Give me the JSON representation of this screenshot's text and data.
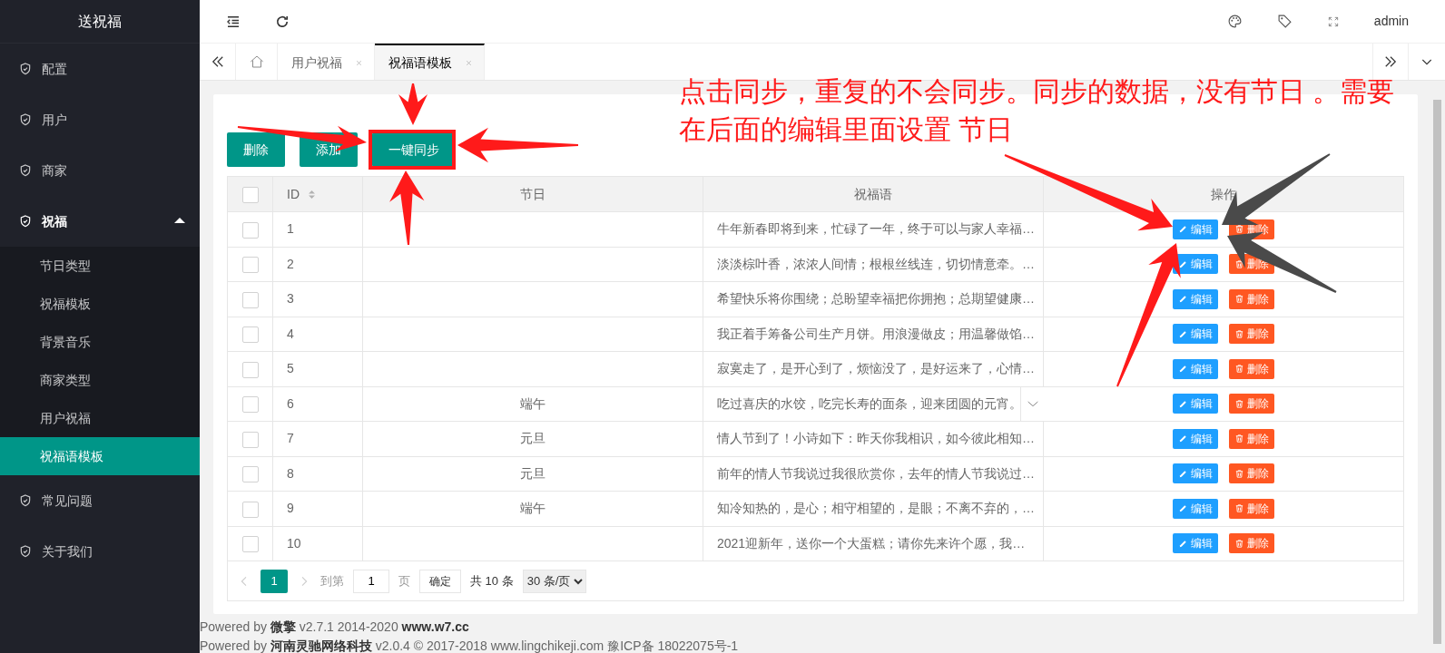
{
  "sidebar": {
    "title": "送祝福",
    "items": [
      {
        "label": "配置",
        "expanded": false
      },
      {
        "label": "用户",
        "expanded": false
      },
      {
        "label": "商家",
        "expanded": false
      },
      {
        "label": "祝福",
        "expanded": true,
        "children": [
          {
            "label": "节日类型",
            "selected": false
          },
          {
            "label": "祝福模板",
            "selected": false
          },
          {
            "label": "背景音乐",
            "selected": false
          },
          {
            "label": "商家类型",
            "selected": false
          },
          {
            "label": "用户祝福",
            "selected": false
          },
          {
            "label": "祝福语模板",
            "selected": true
          }
        ]
      },
      {
        "label": "常见问题",
        "expanded": false
      },
      {
        "label": "关于我们",
        "expanded": false
      }
    ]
  },
  "header": {
    "user": "admin"
  },
  "tabs": [
    {
      "label": "用户祝福",
      "selected": false
    },
    {
      "label": "祝福语模板",
      "selected": true
    }
  ],
  "toolbar": [
    {
      "label": "删除"
    },
    {
      "label": "添加"
    },
    {
      "label": "一键同步"
    }
  ],
  "table": {
    "header_checked": false,
    "columns": [
      {
        "kind": "checkbox"
      },
      {
        "kind": "sort",
        "label": "ID"
      },
      {
        "kind": "text",
        "label": "节日"
      },
      {
        "kind": "text",
        "label": "祝福语"
      },
      {
        "kind": "text",
        "label": "操作"
      }
    ],
    "rows": [
      {
        "checked": false,
        "id": "1",
        "festival": "",
        "text": "牛年新春即将到来，忙碌了一年，终于可以与家人幸福…",
        "expand_toggle": false,
        "actions": [
          {
            "kind": "edit",
            "label": "编辑"
          },
          {
            "kind": "delete",
            "label": "删除"
          }
        ]
      },
      {
        "checked": false,
        "id": "2",
        "festival": "",
        "text": "淡淡棕叶香，浓浓人间情；根根丝线连，切切情意牵。…",
        "expand_toggle": false,
        "actions": [
          {
            "kind": "edit",
            "label": "编辑"
          },
          {
            "kind": "delete",
            "label": "删除"
          }
        ]
      },
      {
        "checked": false,
        "id": "3",
        "festival": "",
        "text": "希望快乐将你围绕；总盼望幸福把你拥抱；总期望健康…",
        "expand_toggle": false,
        "actions": [
          {
            "kind": "edit",
            "label": "编辑"
          },
          {
            "kind": "delete",
            "label": "删除"
          }
        ]
      },
      {
        "checked": false,
        "id": "4",
        "festival": "",
        "text": "我正着手筹备公司生产月饼。用浪漫做皮；用温馨做馅…",
        "expand_toggle": false,
        "actions": [
          {
            "kind": "edit",
            "label": "编辑"
          },
          {
            "kind": "delete",
            "label": "删除"
          }
        ]
      },
      {
        "checked": false,
        "id": "5",
        "festival": "",
        "text": "寂寞走了，是开心到了，烦恼没了，是好运来了，心情…",
        "expand_toggle": false,
        "actions": [
          {
            "kind": "edit",
            "label": "编辑"
          },
          {
            "kind": "delete",
            "label": "删除"
          }
        ]
      },
      {
        "checked": false,
        "id": "6",
        "festival": "端午",
        "text": "吃过喜庆的水饺，吃完长寿的面条，迎来团圆的元宵。",
        "expand_toggle": true,
        "actions": [
          {
            "kind": "edit",
            "label": "编辑"
          },
          {
            "kind": "delete",
            "label": "删除"
          }
        ]
      },
      {
        "checked": false,
        "id": "7",
        "festival": "元旦",
        "text": "情人节到了！小诗如下：昨天你我相识，如今彼此相知…",
        "expand_toggle": false,
        "actions": [
          {
            "kind": "edit",
            "label": "编辑"
          },
          {
            "kind": "delete",
            "label": "删除"
          }
        ]
      },
      {
        "checked": false,
        "id": "8",
        "festival": "元旦",
        "text": "前年的情人节我说过我很欣赏你，去年的情人节我说过…",
        "expand_toggle": false,
        "actions": [
          {
            "kind": "edit",
            "label": "编辑"
          },
          {
            "kind": "delete",
            "label": "删除"
          }
        ]
      },
      {
        "checked": false,
        "id": "9",
        "festival": "端午",
        "text": "知冷知热的，是心；相守相望的，是眼；不离不弃的，…",
        "expand_toggle": false,
        "actions": [
          {
            "kind": "edit",
            "label": "编辑"
          },
          {
            "kind": "delete",
            "label": "删除"
          }
        ]
      },
      {
        "checked": false,
        "id": "10",
        "festival": "",
        "text": "2021迎新年，送你一个大蛋糕；请你先来许个愿，我…",
        "expand_toggle": false,
        "actions": [
          {
            "kind": "edit",
            "label": "编辑"
          },
          {
            "kind": "delete",
            "label": "删除"
          }
        ]
      }
    ]
  },
  "pagination": {
    "current_page": "1",
    "goto_label": "到第",
    "page_input": "1",
    "page_unit": "页",
    "confirm": "确定",
    "total": "共 10 条",
    "page_size": "30 条/页"
  },
  "footer": [
    "Powered by **微擎** v2.7.1 2014-2020 **www.w7.cc**",
    "Powered by **河南灵驰网络科技** v2.0.4 © 2017-2018 www.lingchikeji.com 豫ICP备 18022075号-1"
  ],
  "annotation": {
    "note": "点击同步，重复的不会同步。同步的数据，没有节日 。需要在后面的编辑里面设置 节日"
  }
}
